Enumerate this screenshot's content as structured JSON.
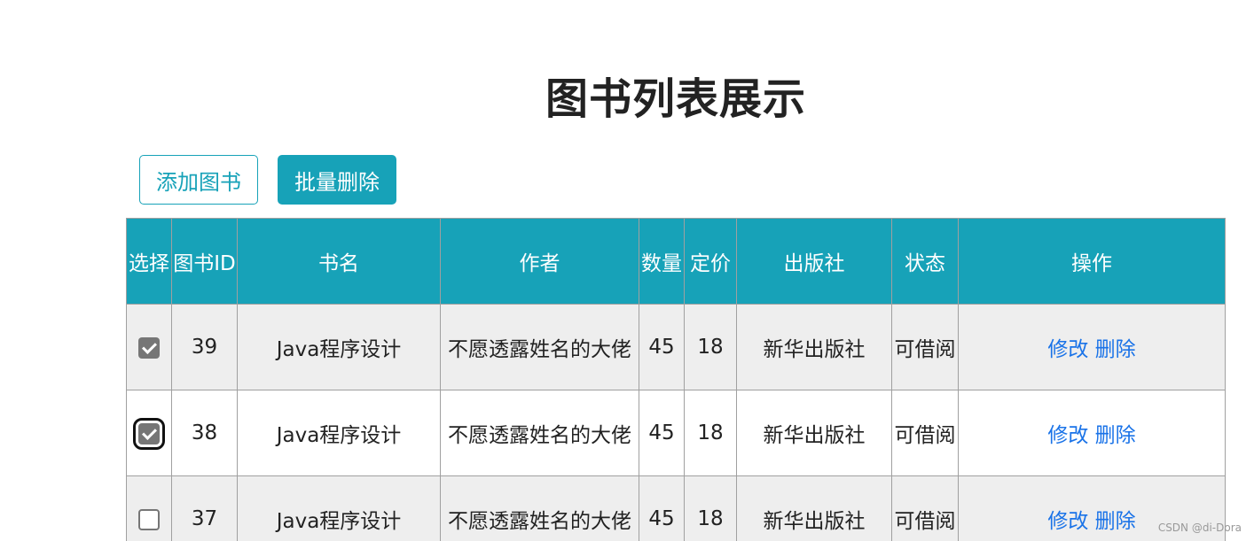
{
  "page": {
    "title": "图书列表展示"
  },
  "toolbar": {
    "add_label": "添加图书",
    "batch_delete_label": "批量删除"
  },
  "table": {
    "headers": [
      "选择",
      "图书ID",
      "书名",
      "作者",
      "数量",
      "定价",
      "出版社",
      "状态",
      "操作"
    ],
    "rows": [
      {
        "checked": true,
        "id": "39",
        "name": "Java程序设计",
        "author": "不愿透露姓名的大佬",
        "count": "45",
        "price": "18",
        "publisher": "新华出版社",
        "status": "可借阅",
        "edit": "修改",
        "delete": "删除"
      },
      {
        "checked": true,
        "id": "38",
        "name": "Java程序设计",
        "author": "不愿透露姓名的大佬",
        "count": "45",
        "price": "18",
        "publisher": "新华出版社",
        "status": "可借阅",
        "edit": "修改",
        "delete": "删除"
      },
      {
        "checked": false,
        "id": "37",
        "name": "Java程序设计",
        "author": "不愿透露姓名的大佬",
        "count": "45",
        "price": "18",
        "publisher": "新华出版社",
        "status": "可借阅",
        "edit": "修改",
        "delete": "删除"
      }
    ]
  },
  "watermark": "CSDN @di-Dora",
  "colors": {
    "accent": "#17a2b8",
    "link": "#1a73e8",
    "row_alt": "#eeeeee"
  }
}
